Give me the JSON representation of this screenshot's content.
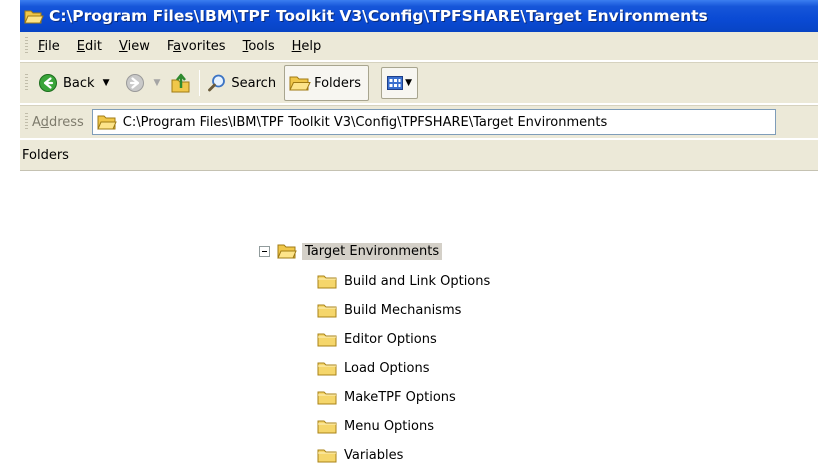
{
  "window": {
    "title": "C:\\Program Files\\IBM\\TPF Toolkit V3\\Config\\TPFSHARE\\Target Environments"
  },
  "menubar": {
    "items": [
      {
        "pre": "",
        "u": "F",
        "post": "ile"
      },
      {
        "pre": "",
        "u": "E",
        "post": "dit"
      },
      {
        "pre": "",
        "u": "V",
        "post": "iew"
      },
      {
        "pre": "F",
        "u": "a",
        "post": "vorites"
      },
      {
        "pre": "",
        "u": "T",
        "post": "ools"
      },
      {
        "pre": "",
        "u": "H",
        "post": "elp"
      }
    ]
  },
  "toolbar": {
    "back_label": "Back",
    "search_label": "Search",
    "folders_label": "Folders"
  },
  "address": {
    "label_pre": "A",
    "label_u": "d",
    "label_post": "dress",
    "value": "C:\\Program Files\\IBM\\TPF Toolkit V3\\Config\\TPFSHARE\\Target Environments"
  },
  "folders_pane": {
    "header": "Folders",
    "selected": "Target Environments",
    "children": [
      "Build and Link Options",
      "Build Mechanisms",
      "Editor Options",
      "Load Options",
      "MakeTPF Options",
      "Menu Options",
      "Variables"
    ]
  },
  "colors": {
    "titlebar": "#0a4ad4",
    "chrome": "#ece9d8",
    "selection": "#d4d0c8",
    "folder": "#f5d66b"
  }
}
